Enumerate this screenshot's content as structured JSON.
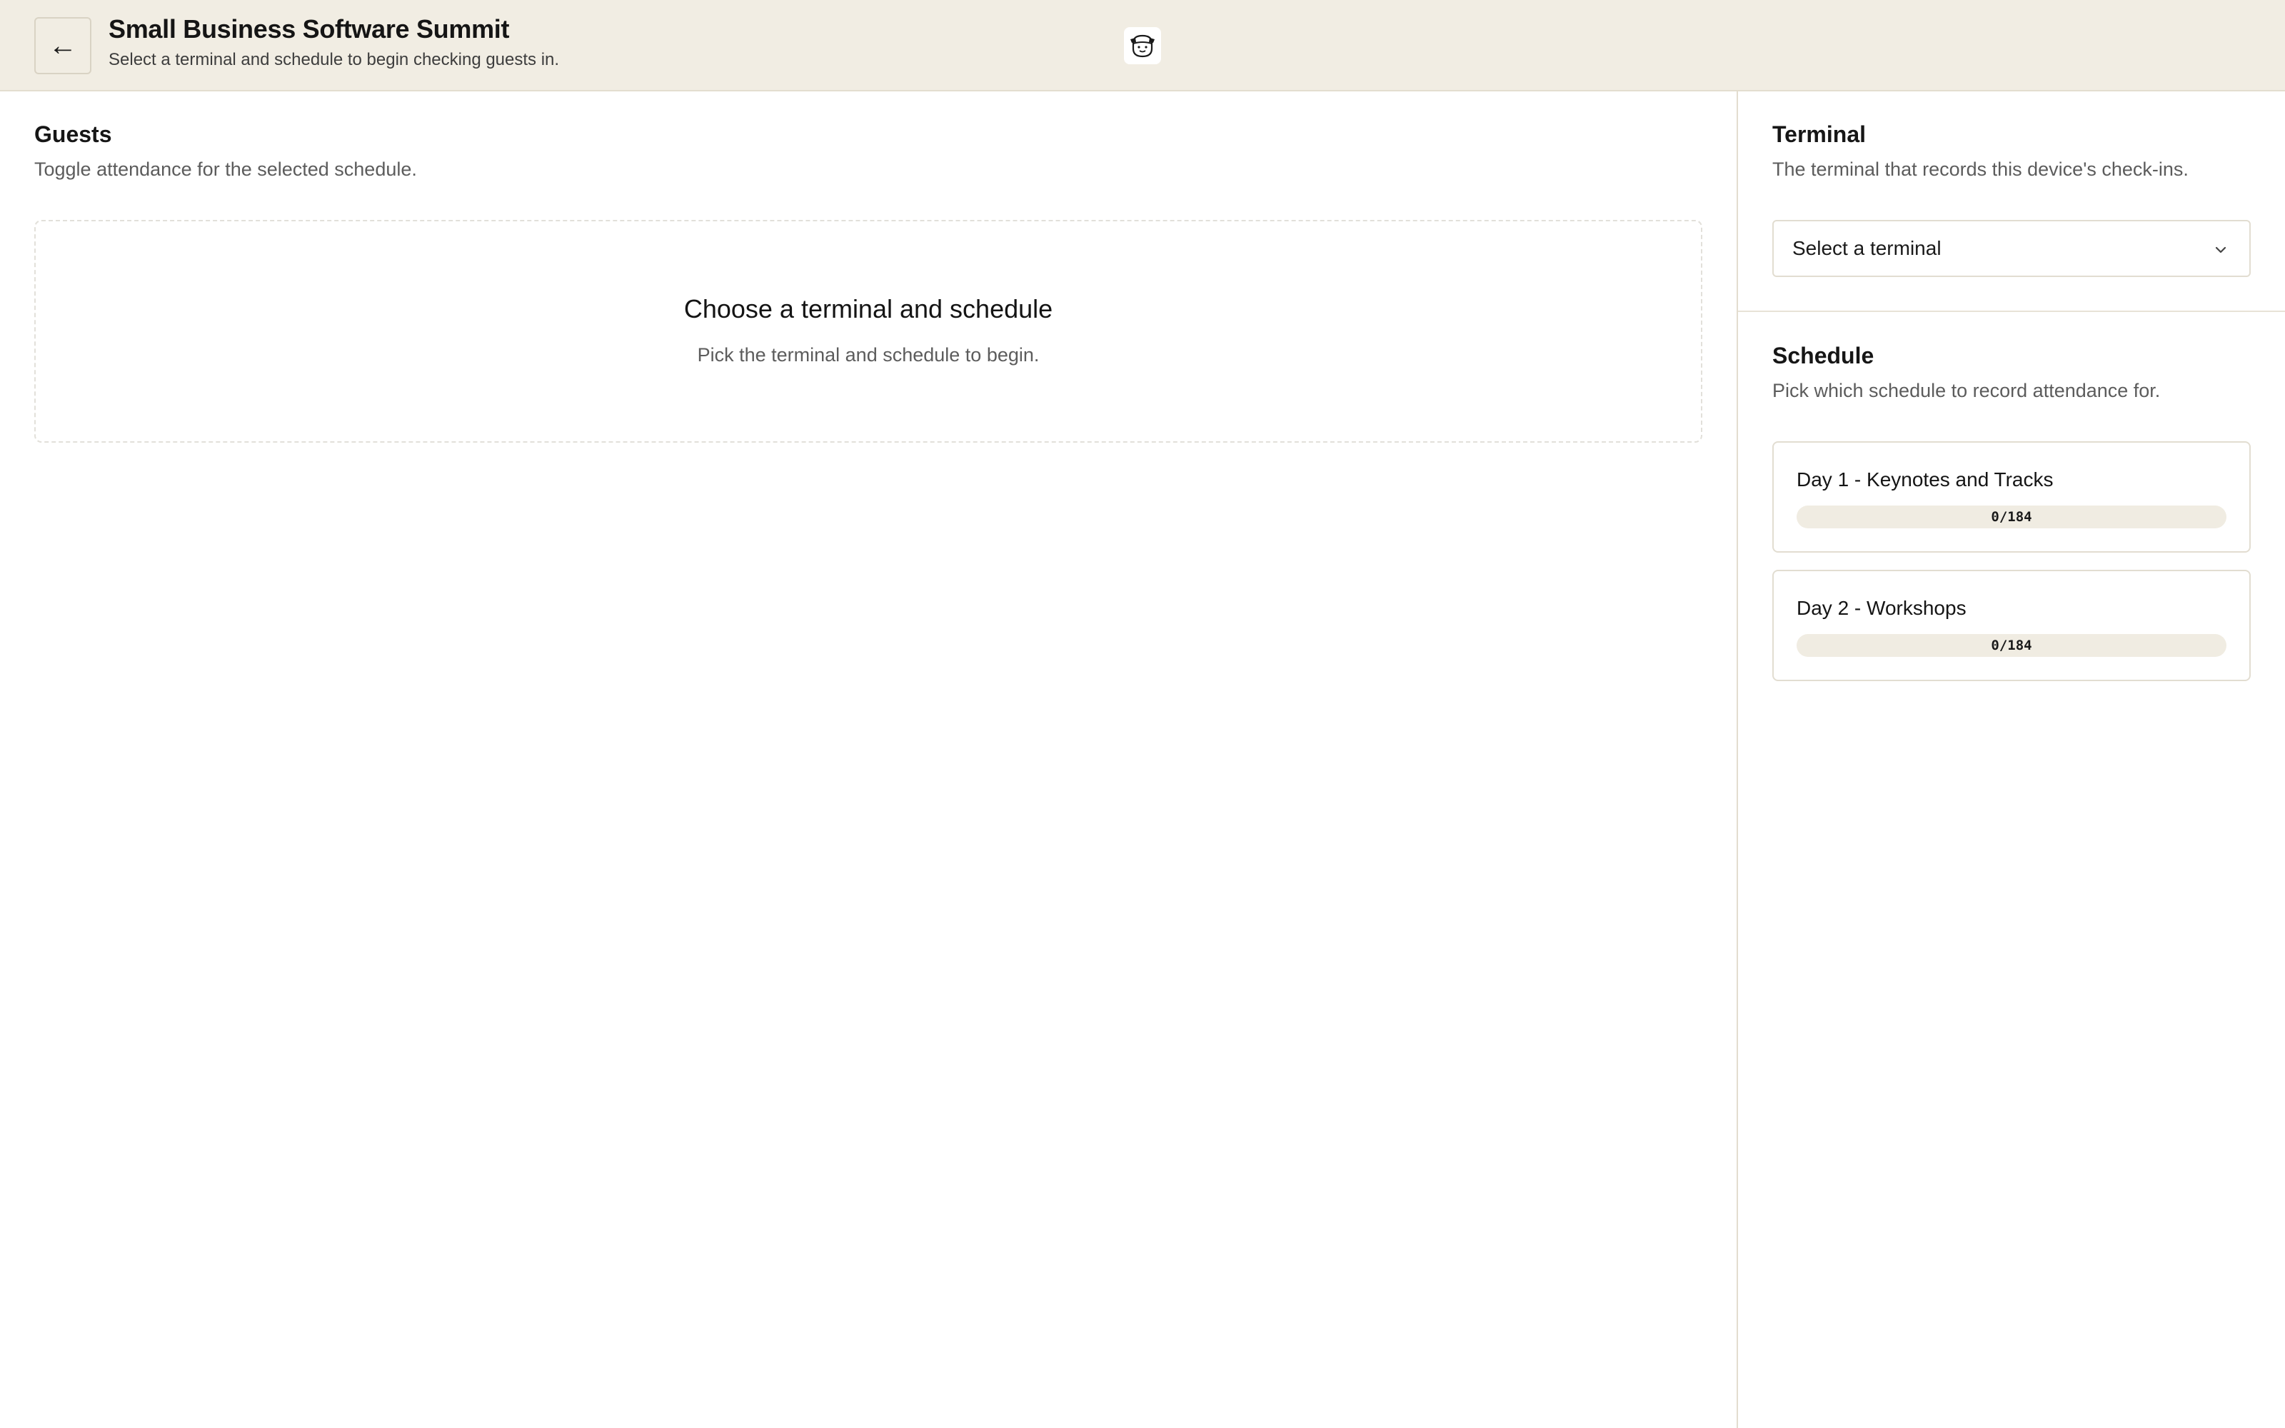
{
  "header": {
    "back_icon": "arrow-left-icon",
    "back_glyph": "←",
    "title": "Small Business Software Summit",
    "subtitle": "Select a terminal and schedule to begin checking guests in.",
    "logo_icon": "mascot-logo-icon"
  },
  "guests": {
    "title": "Guests",
    "description": "Toggle attendance for the selected schedule.",
    "empty_state": {
      "title": "Choose a terminal and schedule",
      "description": "Pick the terminal and schedule to begin."
    }
  },
  "terminal": {
    "title": "Terminal",
    "description": "The terminal that records this device's check-ins.",
    "select_placeholder": "Select a terminal",
    "select_icon": "chevron-down-icon"
  },
  "schedule": {
    "title": "Schedule",
    "description": "Pick which schedule to record attendance for.",
    "items": [
      {
        "name": "Day 1 - Keynotes and Tracks",
        "progress_label": "0/184",
        "checked_in": 0,
        "total": 184
      },
      {
        "name": "Day 2 - Workshops",
        "progress_label": "0/184",
        "checked_in": 0,
        "total": 184
      }
    ]
  },
  "colors": {
    "header_bg": "#f1ede3",
    "border": "#e3ddcf",
    "progress_track": "#f0ece2",
    "text_primary": "#151515",
    "text_muted": "#5c5c5c"
  }
}
